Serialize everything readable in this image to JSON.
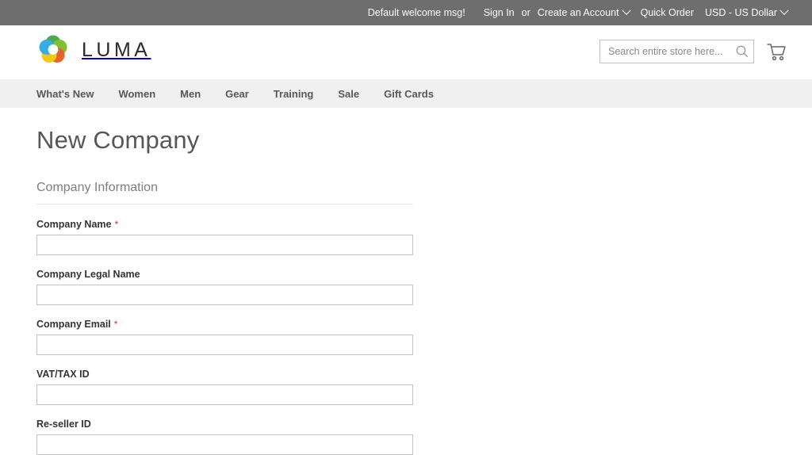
{
  "top_panel": {
    "welcome_msg": "Default welcome msg!",
    "sign_in": "Sign In",
    "separator": "or",
    "create_account": "Create an Account",
    "quick_order": "Quick Order",
    "currency": "USD - US Dollar"
  },
  "header": {
    "logo_text": "LUMA",
    "logo_icon": "luma-flower-logo",
    "search": {
      "placeholder": "Search entire store here...",
      "value": "",
      "icon": "search-icon"
    },
    "cart_icon": "shopping-cart-icon"
  },
  "nav": {
    "items": [
      {
        "label": "What's New",
        "name": "whats-new"
      },
      {
        "label": "Women",
        "name": "women"
      },
      {
        "label": "Men",
        "name": "men"
      },
      {
        "label": "Gear",
        "name": "gear"
      },
      {
        "label": "Training",
        "name": "training"
      },
      {
        "label": "Sale",
        "name": "sale"
      },
      {
        "label": "Gift Cards",
        "name": "gift-cards"
      }
    ]
  },
  "main": {
    "page_title": "New Company",
    "fieldset_legend": "Company Information",
    "required_marker": "*",
    "fields": [
      {
        "label": "Company Name",
        "required": true,
        "value": "",
        "placeholder": "",
        "name": "company-name"
      },
      {
        "label": "Company Legal Name",
        "required": false,
        "value": "",
        "placeholder": "",
        "name": "company-legal-name"
      },
      {
        "label": "Company Email",
        "required": true,
        "value": "",
        "placeholder": "",
        "name": "company-email"
      },
      {
        "label": "VAT/TAX ID",
        "required": false,
        "value": "",
        "placeholder": "",
        "name": "vat-tax-id"
      },
      {
        "label": "Re-seller ID",
        "required": false,
        "value": "",
        "placeholder": "",
        "name": "re-seller-id"
      }
    ]
  },
  "colors": {
    "top_panel_bg": "#6e6e6e",
    "nav_bg": "#f0f0f0",
    "required_red": "#e02b27",
    "text_dark": "#333333",
    "text_muted": "#575757",
    "border": "#c2c2c2"
  }
}
